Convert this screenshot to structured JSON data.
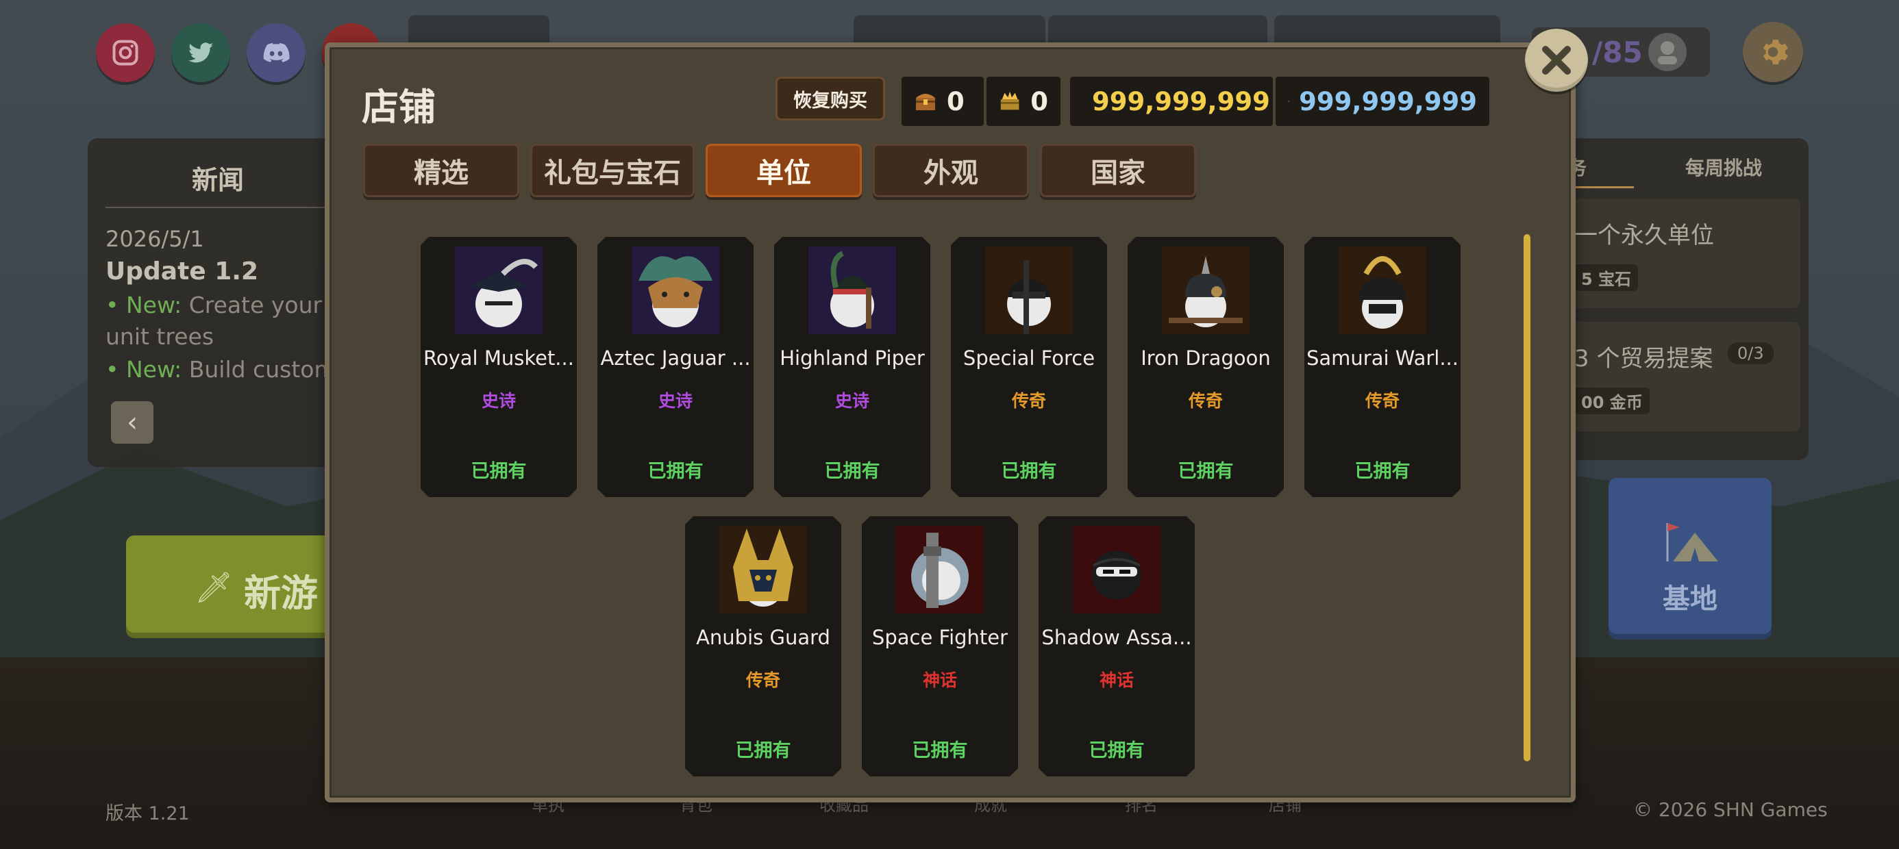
{
  "background": {
    "social": [
      {
        "name": "instagram-icon",
        "color": "#8e2a3c"
      },
      {
        "name": "twitter-icon",
        "color": "#2b5a4d"
      },
      {
        "name": "discord-icon",
        "color": "#4a4f7d"
      },
      {
        "name": "youtube-icon",
        "color": "#8e2a2a"
      }
    ],
    "news": {
      "title": "新闻",
      "date": "2026/5/1",
      "headline": "Update 1.2",
      "lines": [
        {
          "tag": "• New:",
          "text": " Create your c"
        },
        {
          "tag": "",
          "text": "unit trees"
        },
        {
          "tag": "• New:",
          "text": " Build custom"
        }
      ],
      "back_label": "‹"
    },
    "new_game": {
      "label": "新游戏",
      "visible_label": "新游"
    },
    "tasks": {
      "tab_left": "务",
      "tab_right": "每周挑战",
      "items": [
        {
          "text": "一个永久单位",
          "reward": "5 宝石"
        },
        {
          "text": "3 个贸易提案",
          "reward": "00 金币",
          "progress": "0/3"
        }
      ]
    },
    "base_button": {
      "label": "基地"
    },
    "level": {
      "value": "/85"
    },
    "version": "版本 1.21",
    "copyright": "© 2026 SHN Games",
    "bottom_nav": [
      "单执",
      "背包",
      "收藏品",
      "成就",
      "排名",
      "店铺"
    ]
  },
  "shop": {
    "title": "店铺",
    "restore_label": "恢复购买",
    "currencies": [
      {
        "icon": "chest-icon",
        "value": "0"
      },
      {
        "icon": "crown-chest-icon",
        "value": "0"
      },
      {
        "icon": "silver-coin-icon",
        "value": "999,999,999",
        "style": "gold"
      },
      {
        "icon": "purple-gem-icon",
        "value": "999,999,999",
        "style": "blue"
      }
    ],
    "tabs": [
      {
        "label": "精选",
        "active": false
      },
      {
        "label": "礼包与宝石",
        "active": false
      },
      {
        "label": "单位",
        "active": true
      },
      {
        "label": "外观",
        "active": false
      },
      {
        "label": "国家",
        "active": false
      }
    ],
    "colors": {
      "epic": "#b04ce0",
      "legendary": "#e69a2a",
      "mythic": "#e0332f",
      "owned": "#5ed163"
    },
    "units": [
      {
        "name": "Royal Musket...",
        "rarity": "史诗",
        "rarity_key": "epic",
        "status": "已拥有",
        "portrait": "tricorn-hat-icon",
        "bg": "#241a3d"
      },
      {
        "name": "Aztec Jaguar ...",
        "rarity": "史诗",
        "rarity_key": "epic",
        "status": "已拥有",
        "portrait": "jaguar-headdress-icon",
        "bg": "#241a3d"
      },
      {
        "name": "Highland Piper",
        "rarity": "史诗",
        "rarity_key": "epic",
        "status": "已拥有",
        "portrait": "feather-bonnet-icon",
        "bg": "#241a3d"
      },
      {
        "name": "Special Force",
        "rarity": "传奇",
        "rarity_key": "legendary",
        "status": "已拥有",
        "portrait": "balaclava-icon",
        "bg": "#2e1d0e"
      },
      {
        "name": "Iron Dragoon",
        "rarity": "传奇",
        "rarity_key": "legendary",
        "status": "已拥有",
        "portrait": "pickelhaube-icon",
        "bg": "#2e1d0e"
      },
      {
        "name": "Samurai Warl...",
        "rarity": "传奇",
        "rarity_key": "legendary",
        "status": "已拥有",
        "portrait": "kabuto-icon",
        "bg": "#2e1d0e"
      },
      {
        "name": "Anubis Guard",
        "rarity": "传奇",
        "rarity_key": "legendary",
        "status": "已拥有",
        "portrait": "anubis-helmet-icon",
        "bg": "#2e1d0e"
      },
      {
        "name": "Space Fighter",
        "rarity": "神话",
        "rarity_key": "mythic",
        "status": "已拥有",
        "portrait": "space-helmet-icon",
        "bg": "#3a0c0c"
      },
      {
        "name": "Shadow Assa...",
        "rarity": "神话",
        "rarity_key": "mythic",
        "status": "已拥有",
        "portrait": "ninja-mask-icon",
        "bg": "#3a0c0c"
      }
    ],
    "close_icon": "close-icon"
  }
}
